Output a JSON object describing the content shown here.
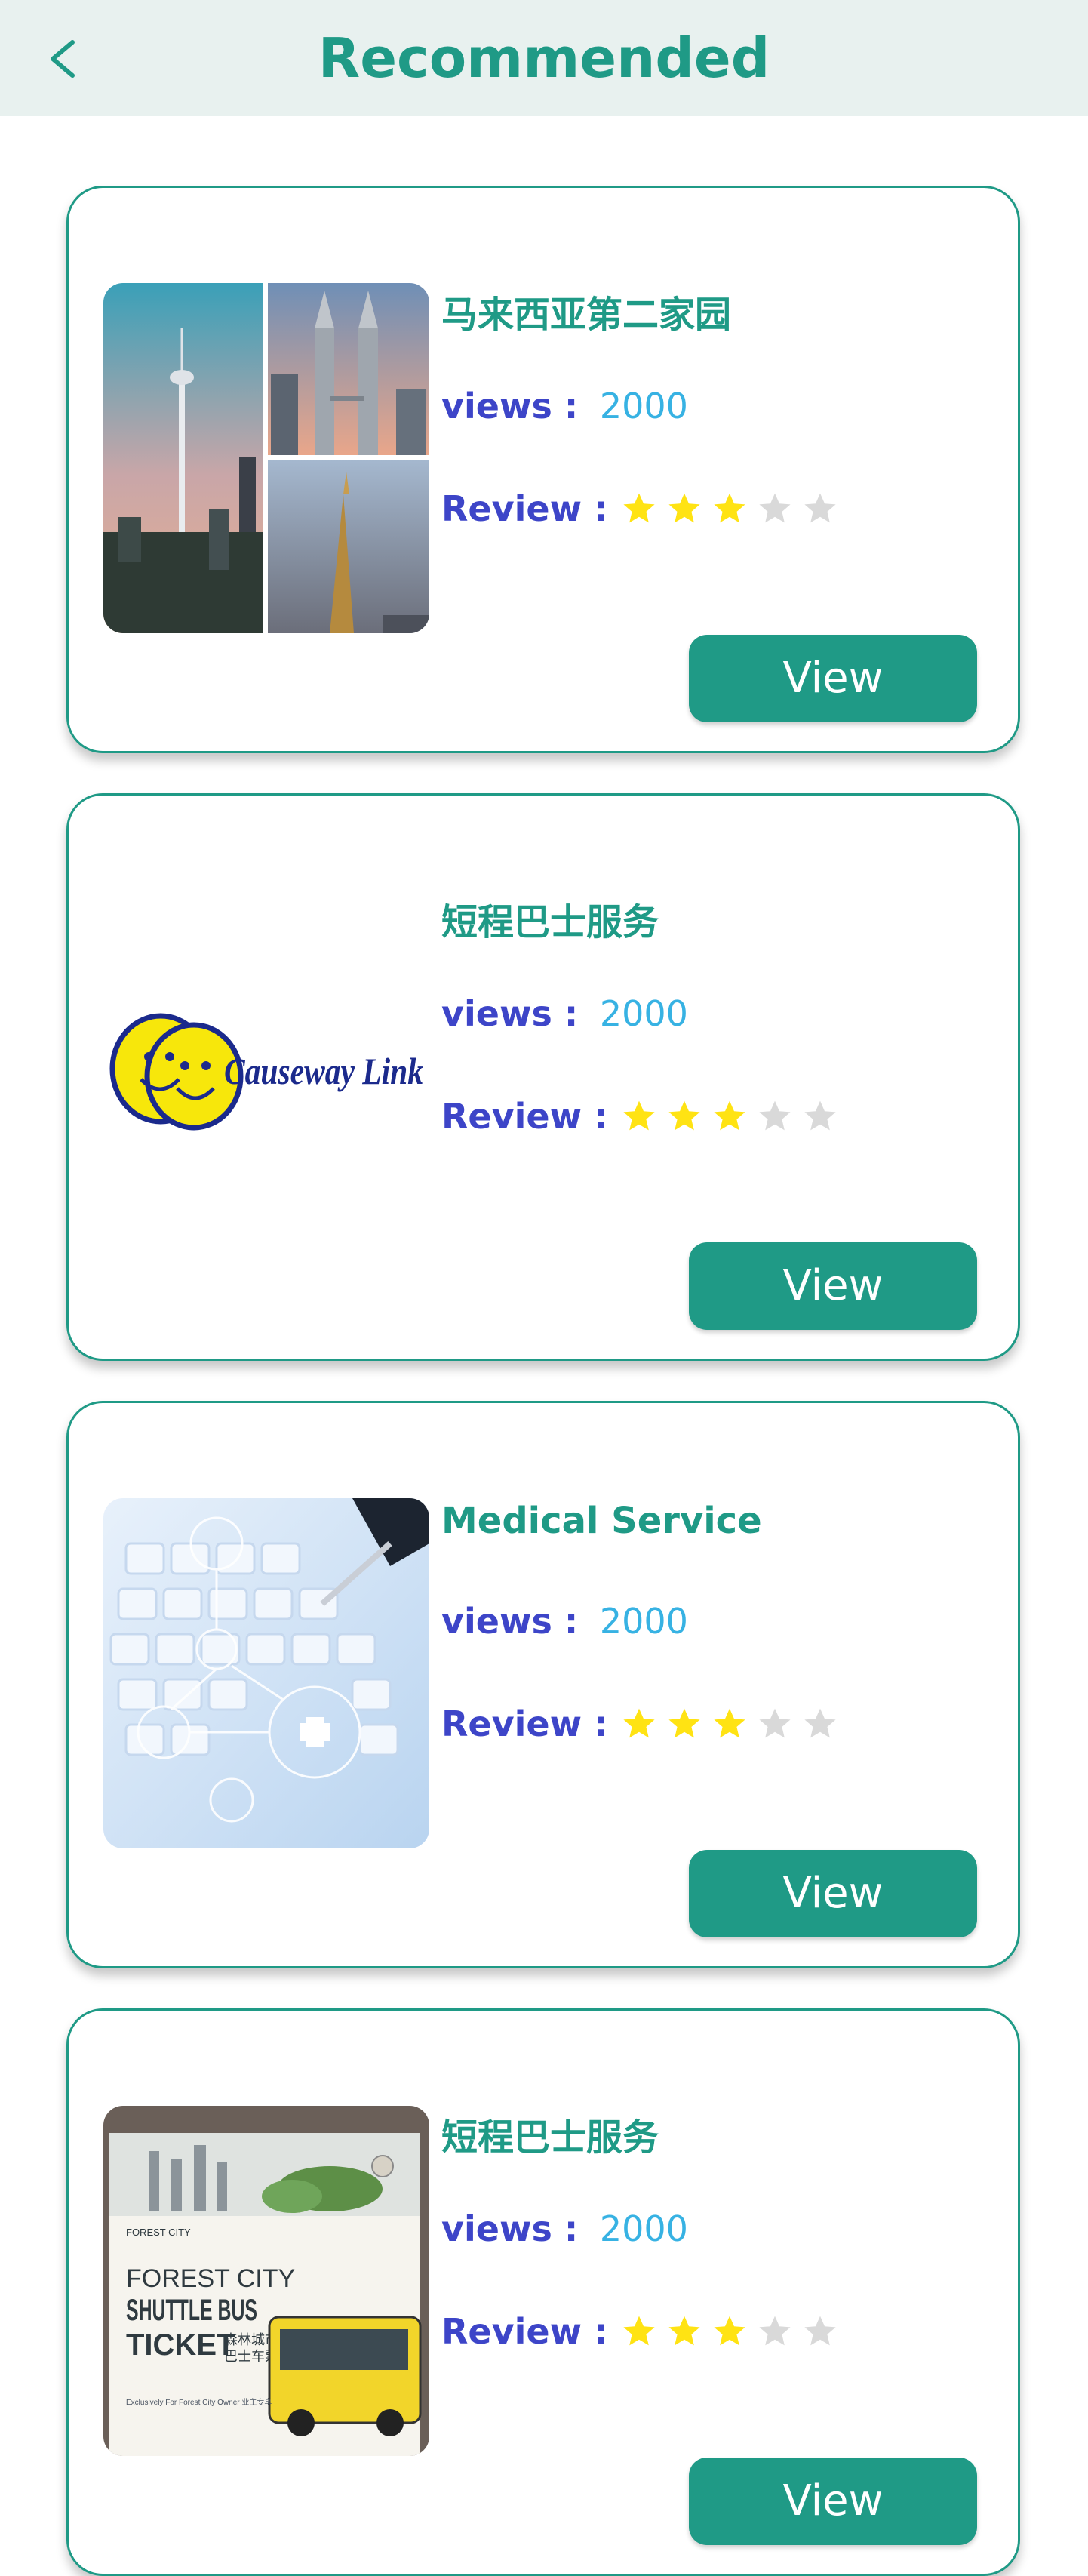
{
  "header": {
    "title": "Recommended",
    "back_icon": "chevron-left-icon"
  },
  "colors": {
    "accent": "#1f9a86",
    "header_bg": "#e8f1ef",
    "label_blue": "#3d45c8",
    "value_blue": "#37b2e3",
    "star_filled": "#ffe313",
    "star_empty": "#d9d9d9"
  },
  "cards": [
    {
      "title": "马来西亚第二家园",
      "views_label": "views :",
      "views": "2000",
      "review_label": "Review :",
      "rating": 3,
      "max_rating": 5,
      "button": "View",
      "image": "kuala-lumpur-skyline-collage"
    },
    {
      "title": "短程巴士服务",
      "views_label": "views :",
      "views": "2000",
      "review_label": "Review :",
      "rating": 3,
      "max_rating": 5,
      "button": "View",
      "image": "causeway-link-logo",
      "logo_text": "Causeway Link"
    },
    {
      "title": "Medical Service",
      "views_label": "views :",
      "views": "2000",
      "review_label": "Review :",
      "rating": 3,
      "max_rating": 5,
      "button": "View",
      "image": "medical-keyboard-icons"
    },
    {
      "title": "短程巴士服务",
      "views_label": "views :",
      "views": "2000",
      "review_label": "Review :",
      "rating": 3,
      "max_rating": 5,
      "button": "View",
      "image": "shuttle-bus-ticket",
      "ticket_text": {
        "brand": "FOREST CITY",
        "line1": "FOREST CITY",
        "line2": "SHUTTLE BUS",
        "line3": "TICKET",
        "chinese": "森林城市穿梭\n巴士车票",
        "footer": "Exclusively For Forest City Owner 业主专享"
      }
    }
  ]
}
